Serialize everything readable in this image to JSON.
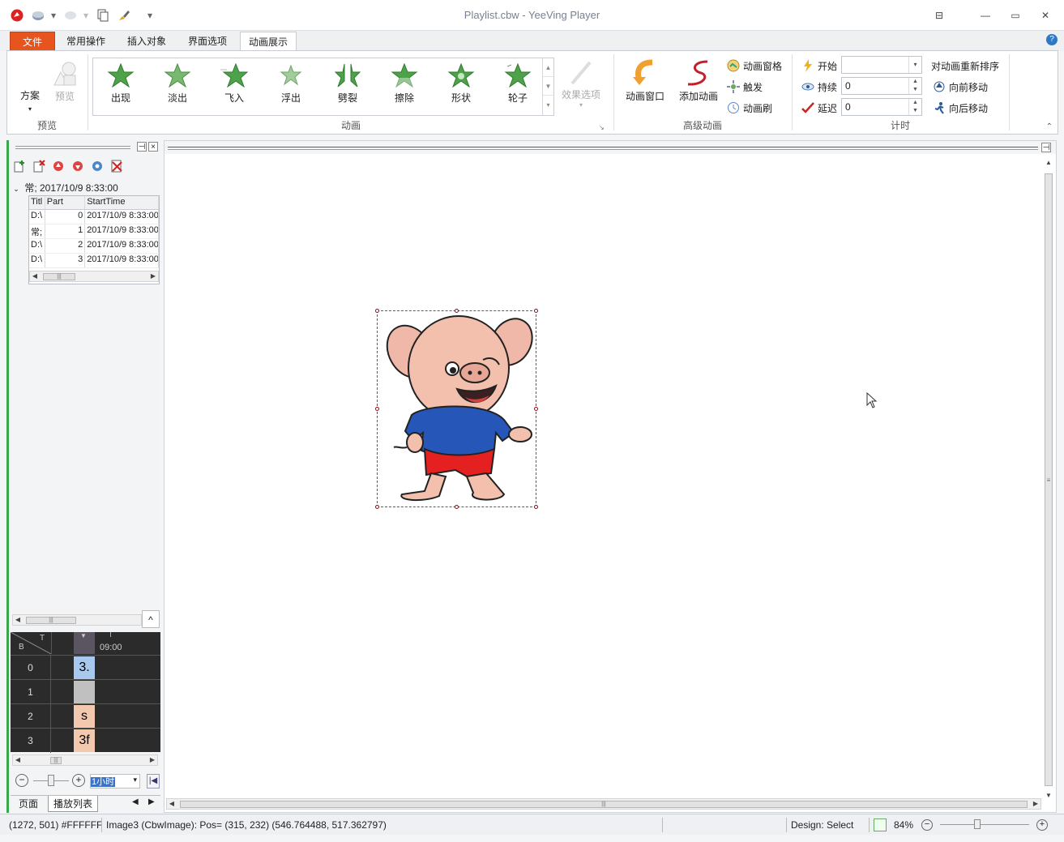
{
  "window": {
    "title": "Playlist.cbw - YeeVing Player"
  },
  "ribbon_tabs": [
    {
      "label": "文件"
    },
    {
      "label": "常用操作"
    },
    {
      "label": "插入对象"
    },
    {
      "label": "界面选项"
    },
    {
      "label": "动画展示"
    }
  ],
  "preview_group": {
    "scheme_label": "方案",
    "preview_label": "预览",
    "group_label": "预览"
  },
  "animation_group": {
    "items": [
      "出现",
      "淡出",
      "飞入",
      "浮出",
      "劈裂",
      "擦除",
      "形状",
      "轮子"
    ],
    "effect_options_label": "效果选项",
    "group_label": "动画"
  },
  "advanced_group": {
    "anim_window_label": "动画窗口",
    "add_anim_label": "添加动画",
    "anim_pane_label": "动画窗格",
    "trigger_label": "触发",
    "anim_brush_label": "动画刷",
    "group_label": "高级动画"
  },
  "timing_group": {
    "start_label": "开始",
    "start_value": "",
    "duration_label": "持续",
    "duration_value": "0",
    "delay_label": "延迟",
    "delay_value": "0",
    "reorder_label": "对动画重新排序",
    "move_earlier_label": "向前移动",
    "move_later_label": "向后移动",
    "group_label": "计时"
  },
  "playlist": {
    "tree_header": "常; 2017/10/9 8:33:00",
    "columns": [
      "Titl",
      "Part",
      "StartTime"
    ],
    "rows": [
      [
        "D:\\",
        "0",
        "2017/10/9 8:33:00"
      ],
      [
        "常;",
        "1",
        "2017/10/9 8:33:00"
      ],
      [
        "D:\\",
        "2",
        "2017/10/9 8:33:00"
      ],
      [
        "D:\\",
        "3",
        "2017/10/9 8:33:00"
      ]
    ]
  },
  "timeline": {
    "corner_top": "T",
    "corner_bottom": "B",
    "time_label": "09:00",
    "rows": [
      {
        "num": "0",
        "cell": "3.",
        "color": "#a9c8ee"
      },
      {
        "num": "1",
        "cell": "",
        "color": "#c0c0c0"
      },
      {
        "num": "2",
        "cell": "s",
        "color": "#f2c8ae"
      },
      {
        "num": "3",
        "cell": "3f",
        "color": "#f2c8ae"
      }
    ],
    "zoom_unit": "1小时"
  },
  "panel_tabs": [
    "页面",
    "播放列表"
  ],
  "status": {
    "cursor_info": "(1272, 501) #FFFFFF",
    "object_info": "Image3 (CbwImage): Pos= (315, 232) (546.764488, 517.362797)",
    "mode": "Design: Select",
    "zoom": "84%"
  },
  "colors": {
    "file_tab": "#e8541d",
    "star_green": "#4ea34a",
    "panel_accent": "#3aa84a",
    "selection_red": "#dd2233"
  }
}
